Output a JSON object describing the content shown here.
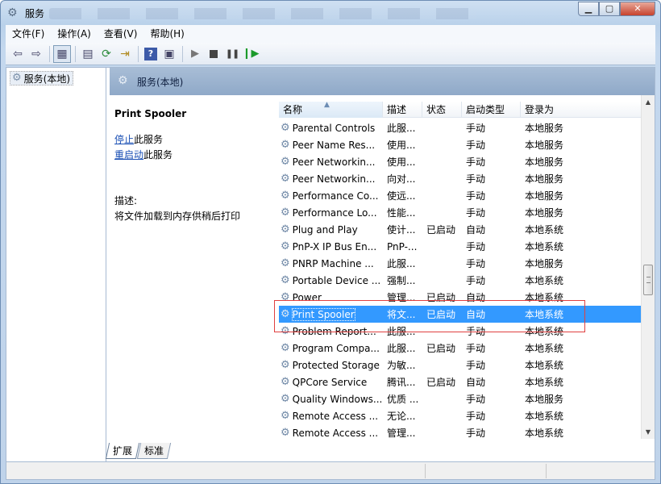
{
  "window": {
    "title": "服务"
  },
  "menu": [
    "文件(F)",
    "操作(A)",
    "查看(V)",
    "帮助(H)"
  ],
  "tree": {
    "root": "服务(本地)"
  },
  "pane": {
    "title": "服务(本地)"
  },
  "detail": {
    "name": "Print Spooler",
    "stop_link": "停止",
    "stop_suffix": "此服务",
    "restart_link": "重启动",
    "restart_suffix": "此服务",
    "desc_label": "描述:",
    "desc_text": "将文件加载到内存供稍后打印"
  },
  "columns": [
    "名称",
    "描述",
    "状态",
    "启动类型",
    "登录为"
  ],
  "services": [
    {
      "name": "Parental Controls",
      "desc": "此服...",
      "status": "",
      "startup": "手动",
      "logon": "本地服务"
    },
    {
      "name": "Peer Name Res...",
      "desc": "使用...",
      "status": "",
      "startup": "手动",
      "logon": "本地服务"
    },
    {
      "name": "Peer Networkin...",
      "desc": "使用...",
      "status": "",
      "startup": "手动",
      "logon": "本地服务"
    },
    {
      "name": "Peer Networkin...",
      "desc": "向对...",
      "status": "",
      "startup": "手动",
      "logon": "本地服务"
    },
    {
      "name": "Performance Co...",
      "desc": "使远...",
      "status": "",
      "startup": "手动",
      "logon": "本地服务"
    },
    {
      "name": "Performance Lo...",
      "desc": "性能...",
      "status": "",
      "startup": "手动",
      "logon": "本地服务"
    },
    {
      "name": "Plug and Play",
      "desc": "使计...",
      "status": "已启动",
      "startup": "自动",
      "logon": "本地系统"
    },
    {
      "name": "PnP-X IP Bus En...",
      "desc": "PnP-...",
      "status": "",
      "startup": "手动",
      "logon": "本地系统"
    },
    {
      "name": "PNRP Machine ...",
      "desc": "此服...",
      "status": "",
      "startup": "手动",
      "logon": "本地服务"
    },
    {
      "name": "Portable Device ...",
      "desc": "强制...",
      "status": "",
      "startup": "手动",
      "logon": "本地系统"
    },
    {
      "name": "Power",
      "desc": "管理...",
      "status": "已启动",
      "startup": "自动",
      "logon": "本地系统"
    },
    {
      "name": "Print Spooler",
      "desc": "将文...",
      "status": "已启动",
      "startup": "自动",
      "logon": "本地系统",
      "selected": true
    },
    {
      "name": "Problem Report...",
      "desc": "此服...",
      "status": "",
      "startup": "手动",
      "logon": "本地系统"
    },
    {
      "name": "Program Compa...",
      "desc": "此服...",
      "status": "已启动",
      "startup": "手动",
      "logon": "本地系统"
    },
    {
      "name": "Protected Storage",
      "desc": "为敏...",
      "status": "",
      "startup": "手动",
      "logon": "本地系统"
    },
    {
      "name": "QPCore Service",
      "desc": "腾讯...",
      "status": "已启动",
      "startup": "自动",
      "logon": "本地系统"
    },
    {
      "name": "Quality Windows...",
      "desc": "优质 ...",
      "status": "",
      "startup": "手动",
      "logon": "本地服务"
    },
    {
      "name": "Remote Access ...",
      "desc": "无论...",
      "status": "",
      "startup": "手动",
      "logon": "本地系统"
    },
    {
      "name": "Remote Access ...",
      "desc": "管理...",
      "status": "",
      "startup": "手动",
      "logon": "本地系统"
    }
  ],
  "tabs": [
    "扩展",
    "标准"
  ],
  "icons": {
    "window": "services-icon",
    "gear": "gear-icon",
    "back": "back-arrow-icon",
    "forward": "forward-arrow-icon",
    "console_tree": "console-tree-icon",
    "properties": "properties-icon",
    "refresh": "refresh-icon",
    "export": "export-list-icon",
    "help": "help-icon",
    "show_hide": "show-hide-pane-icon",
    "start": "start-service-icon",
    "stop": "stop-service-icon",
    "pause": "pause-service-icon",
    "restart": "restart-service-icon"
  },
  "colors": {
    "selection": "#3399ff",
    "highlight_box": "#e04040",
    "link": "#1a4fb4"
  }
}
